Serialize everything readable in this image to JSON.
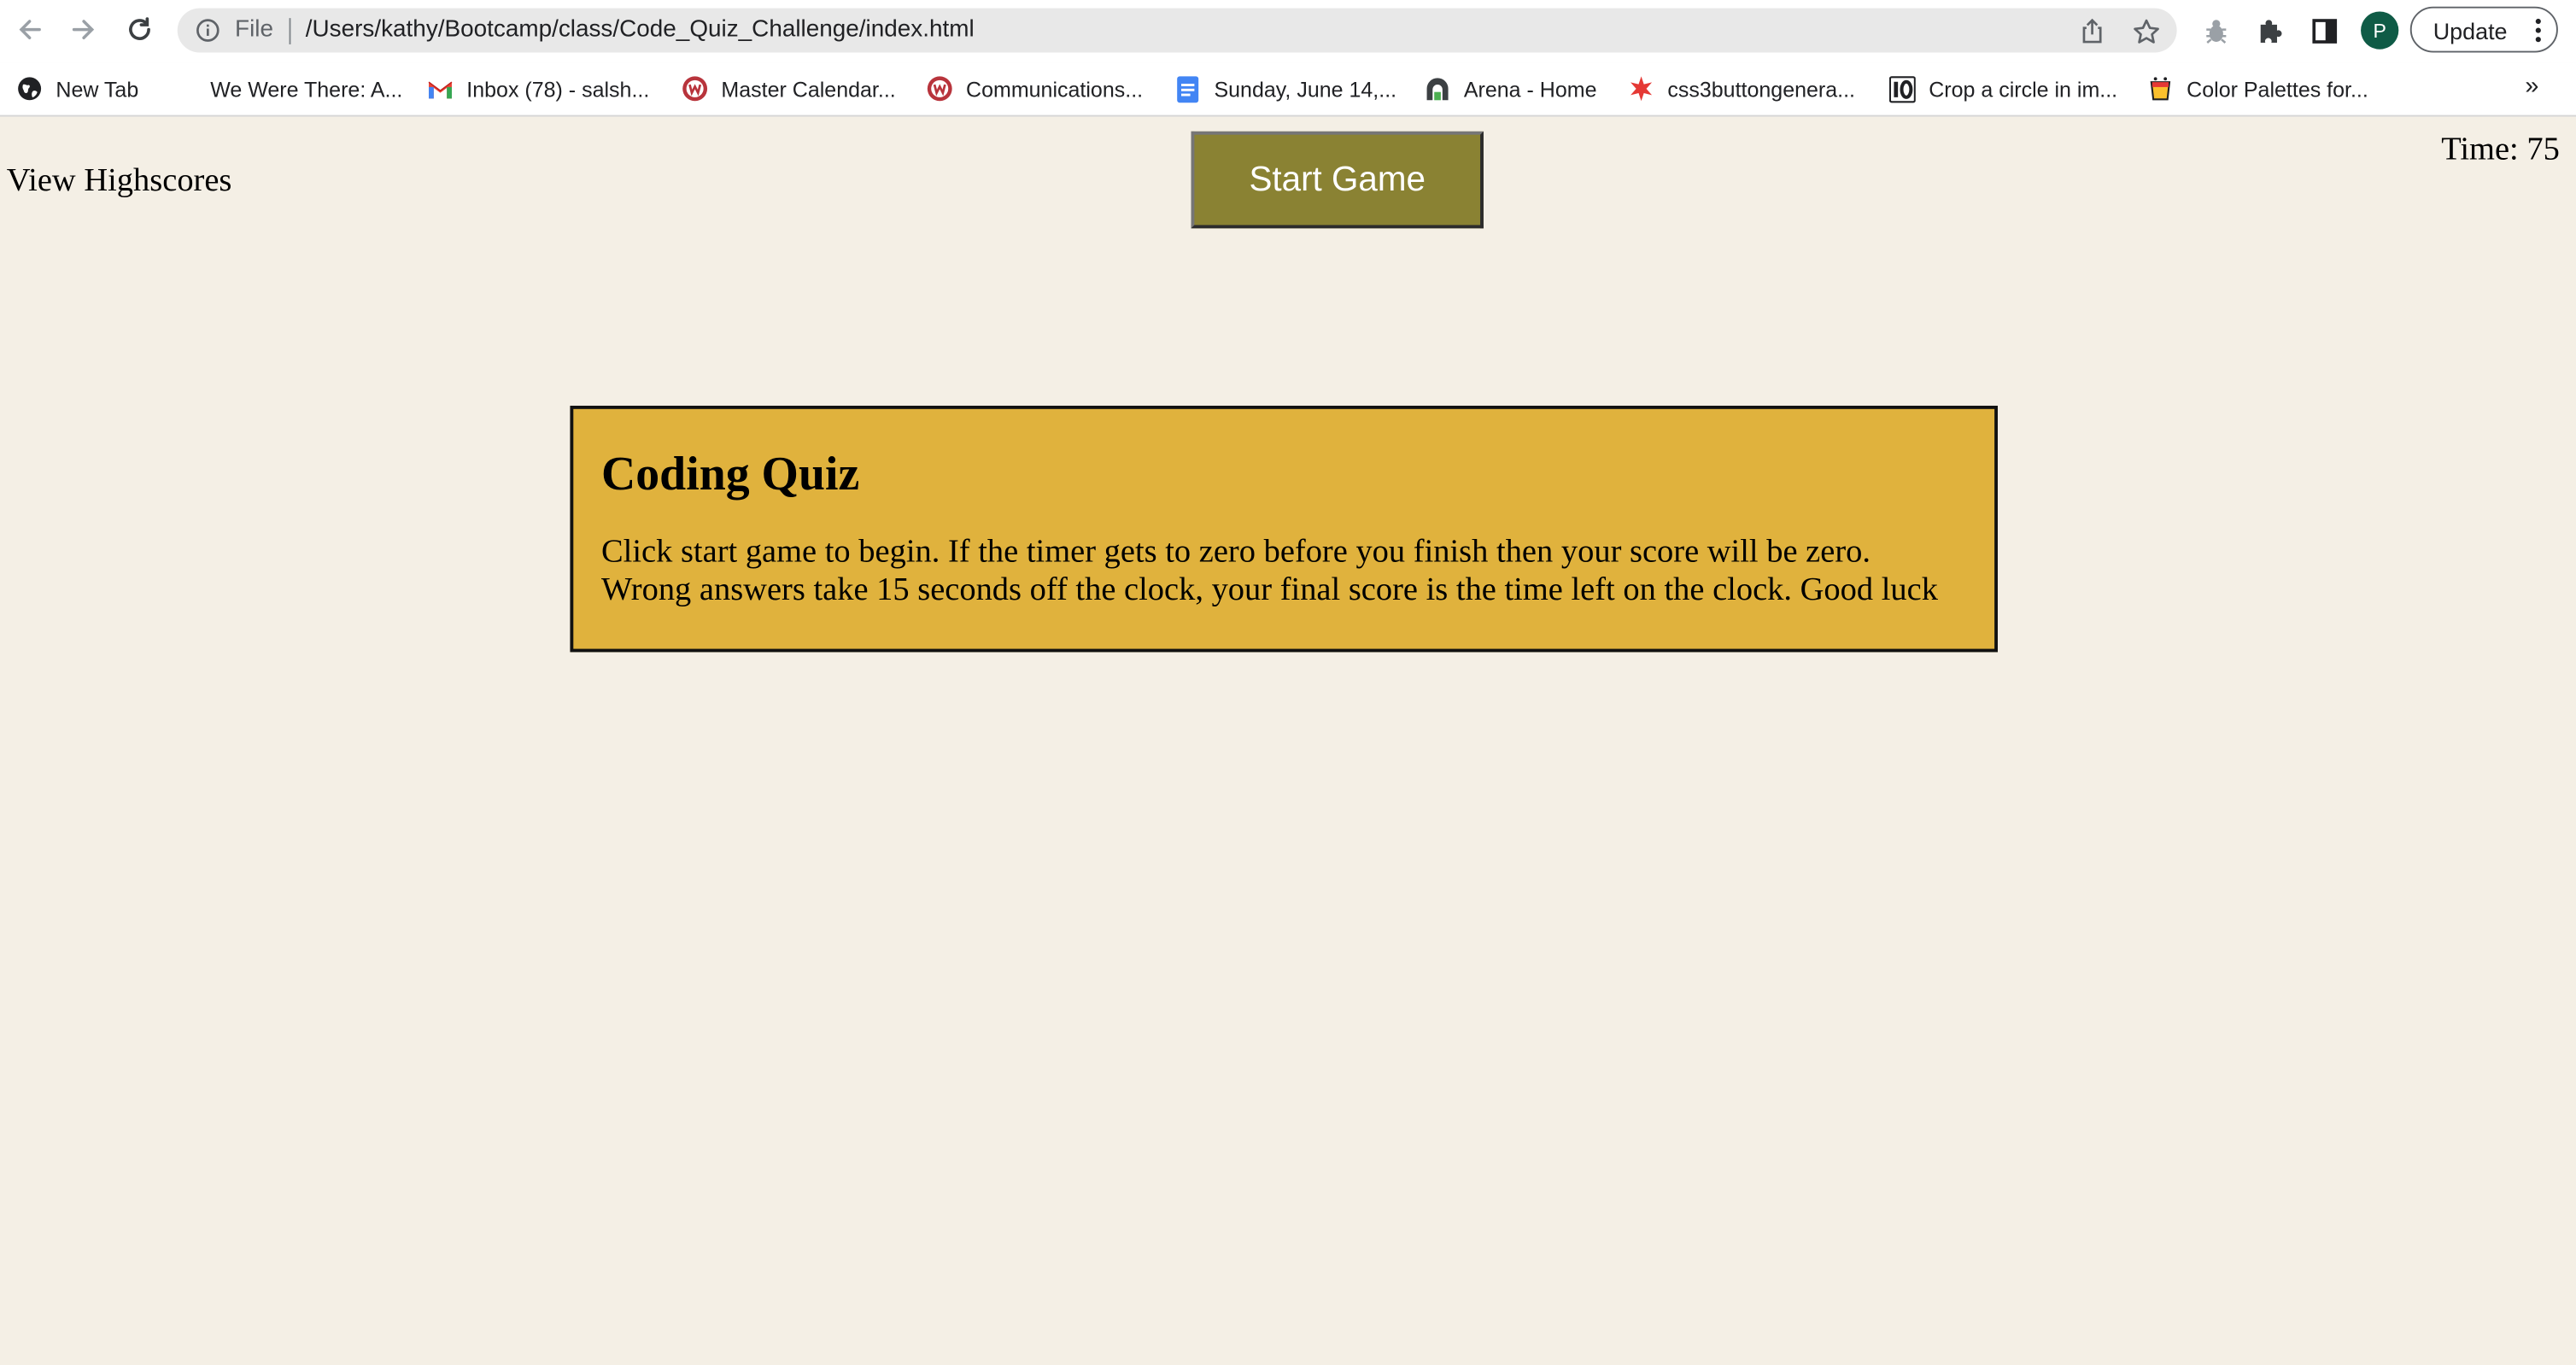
{
  "browser": {
    "address_bar": {
      "scheme_label": "File",
      "url": "/Users/kathy/Bootcamp/class/Code_Quiz_Challenge/index.html"
    },
    "profile_initial": "P",
    "update_label": "Update",
    "bookmarks": [
      {
        "label": "New Tab",
        "icon": "globe-icon"
      },
      {
        "label": "We Were There: A...",
        "icon": "none"
      },
      {
        "label": "Inbox (78) - salsh...",
        "icon": "gmail-icon"
      },
      {
        "label": "Master Calendar...",
        "icon": "w-badge-icon"
      },
      {
        "label": "Communications...",
        "icon": "w-badge-icon"
      },
      {
        "label": "Sunday, June 14,...",
        "icon": "docs-icon"
      },
      {
        "label": "Arena - Home",
        "icon": "arena-icon"
      },
      {
        "label": "css3buttongenera...",
        "icon": "red-star-icon"
      },
      {
        "label": "Crop a circle in im...",
        "icon": "io-icon"
      },
      {
        "label": "Color Palettes for...",
        "icon": "palette-cup-icon"
      }
    ],
    "bookmarks_overflow": "»"
  },
  "page": {
    "highscores_link": "View Highscores",
    "start_button": "Start Game",
    "timer": "Time: 75",
    "quiz": {
      "title": "Coding Quiz",
      "instructions": "Click start game to begin. If the timer gets to zero before you finish then your score will be zero. Wrong answers take 15 seconds off the clock, your final score is the time left on the clock. Good luck"
    }
  },
  "colors": {
    "page_background": "#f4efe5",
    "start_button": "#8a8233",
    "quiz_card": "#e0b23d"
  }
}
